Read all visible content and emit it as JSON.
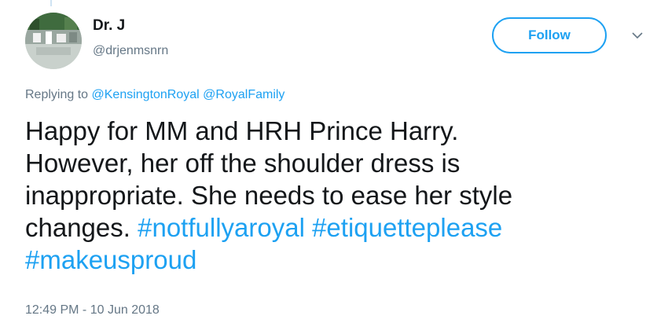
{
  "user": {
    "display_name": "Dr. J",
    "handle": "@drjenmsnrn"
  },
  "follow_button": {
    "label": "Follow"
  },
  "icons": {
    "menu": "chevron-down-icon"
  },
  "reply": {
    "prefix": "Replying to",
    "mentions": [
      "@KensingtonRoyal",
      "@RoyalFamily"
    ]
  },
  "tweet": {
    "line1": "Happy for MM and HRH Prince Harry.",
    "line2": "However, her off the shoulder dress is",
    "line3": "inappropriate. She needs to ease her style",
    "line4_text": "changes.",
    "hashtags": [
      "#notfullyaroyal",
      "#etiquetteplease",
      "#makeusproud"
    ]
  },
  "timestamp": "12:49 PM - 10 Jun 2018",
  "colors": {
    "accent": "#1da1f2",
    "secondary_text": "#657786",
    "primary_text": "#14171a"
  }
}
